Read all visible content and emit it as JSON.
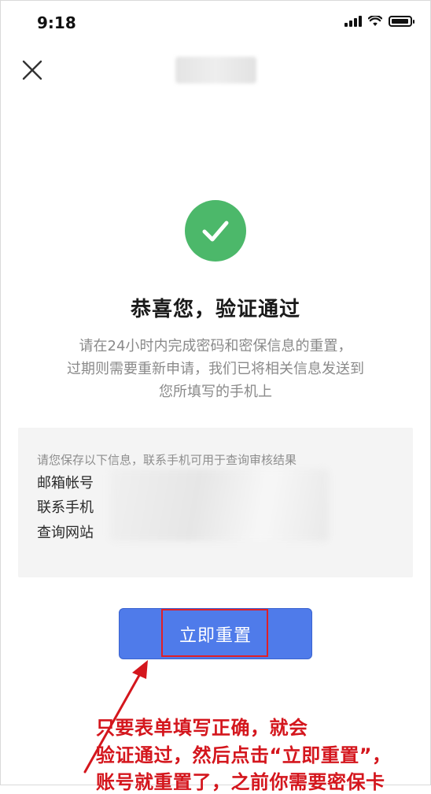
{
  "status_bar": {
    "time": "9:18"
  },
  "main": {
    "headline": "恭喜您，验证通过",
    "description_lines": [
      "请在24小时内完成密码和密保信息的重置，",
      "过期则需要重新申请，我们已将相关信息发送到",
      "您所填写的手机上"
    ]
  },
  "info_card": {
    "hint": "请您保存以下信息，联系手机可用于查询审核结果",
    "rows": [
      {
        "label": "邮箱帐号"
      },
      {
        "label": "联系手机"
      },
      {
        "label": "查询网站"
      }
    ]
  },
  "reset_button": {
    "label": "立即重置"
  },
  "annotation": {
    "lines": [
      "只要表单填写正确，就会",
      "验证通过，然后点击“立即重置”，",
      "账号就重置了，之前你需要密保卡"
    ]
  },
  "colors": {
    "success_green": "#4cb86a",
    "primary_blue": "#4f7bea",
    "annotation_red": "#d4161d"
  }
}
